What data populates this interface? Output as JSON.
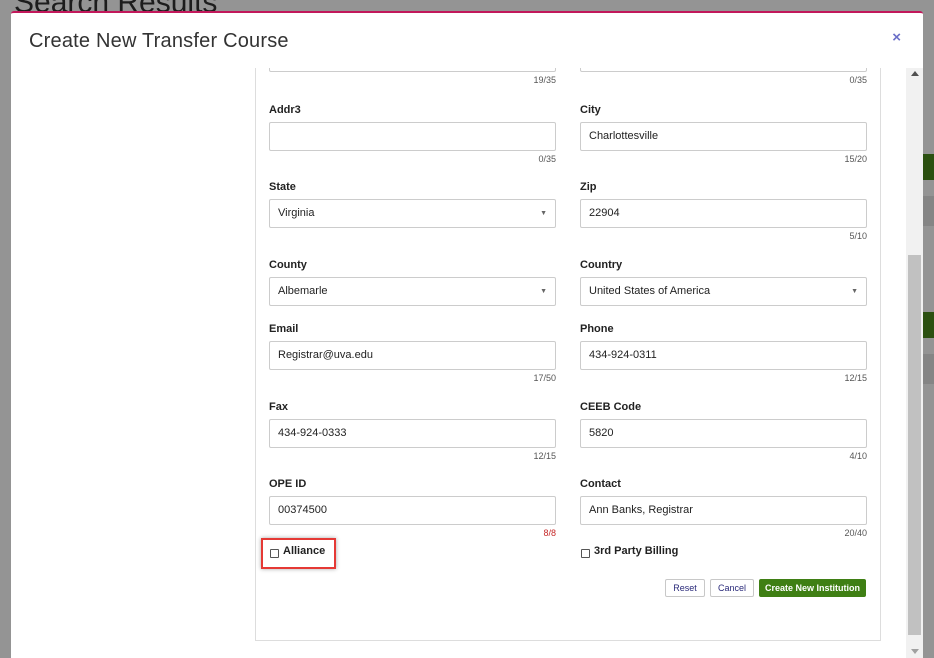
{
  "background": {
    "page_title": "Search Results"
  },
  "modal": {
    "title": "Create New Transfer Course",
    "close_symbol": "×"
  },
  "form": {
    "top_left_counter": "19/35",
    "top_right_counter": "0/35",
    "addr3": {
      "label": "Addr3",
      "value": "",
      "counter": "0/35"
    },
    "city": {
      "label": "City",
      "value": "Charlottesville",
      "counter": "15/20"
    },
    "state": {
      "label": "State",
      "value": "Virginia"
    },
    "zip": {
      "label": "Zip",
      "value": "22904",
      "counter": "5/10"
    },
    "county": {
      "label": "County",
      "value": "Albemarle"
    },
    "country": {
      "label": "Country",
      "value": "United States of America"
    },
    "email": {
      "label": "Email",
      "value": "Registrar@uva.edu",
      "counter": "17/50"
    },
    "phone": {
      "label": "Phone",
      "value": "434-924-0311",
      "counter": "12/15"
    },
    "fax": {
      "label": "Fax",
      "value": "434-924-0333",
      "counter": "12/15"
    },
    "ceeb": {
      "label": "CEEB Code",
      "value": "5820",
      "counter": "4/10"
    },
    "ope_id": {
      "label": "OPE ID",
      "value": "00374500",
      "counter": "8/8"
    },
    "contact": {
      "label": "Contact",
      "value": "Ann Banks, Registrar",
      "counter": "20/40"
    },
    "alliance": {
      "label": "Alliance",
      "checked": false
    },
    "third_party_billing": {
      "label": "3rd Party Billing",
      "checked": false
    }
  },
  "buttons": {
    "reset": "Reset",
    "cancel": "Cancel",
    "create": "Create New Institution"
  },
  "colors": {
    "modal_accent": "#c2185b",
    "primary_button": "#3f7f14",
    "highlight": "#e53935",
    "over_limit_counter": "#c62828"
  }
}
